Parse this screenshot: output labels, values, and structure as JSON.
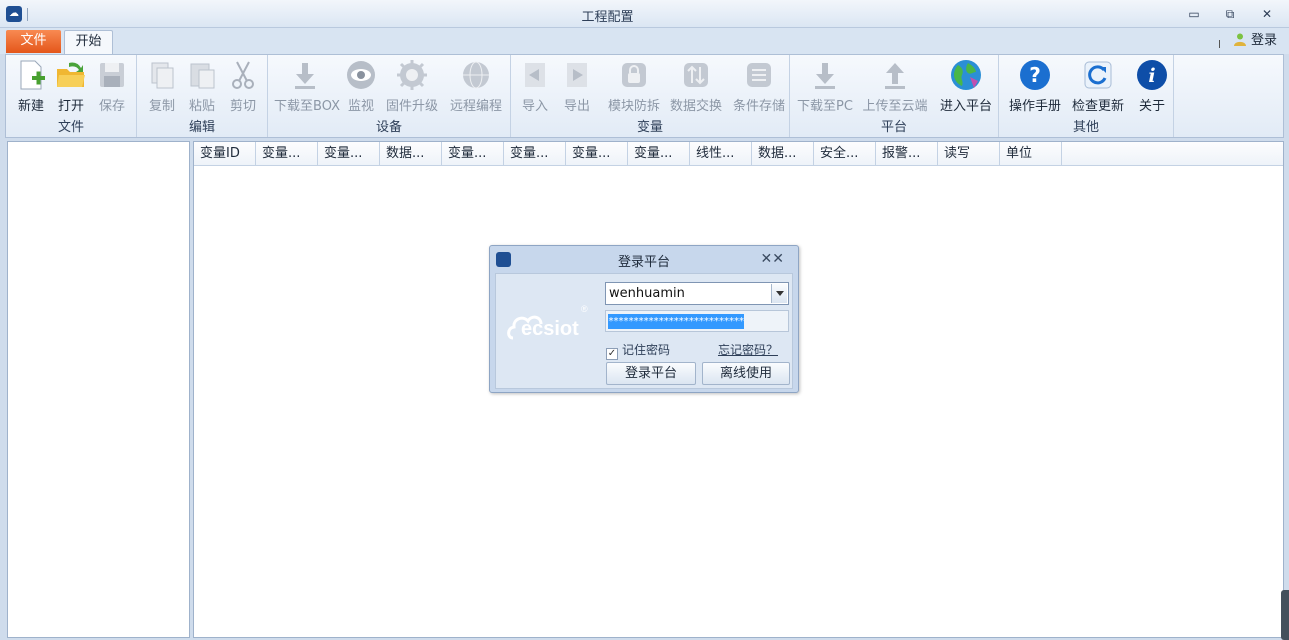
{
  "window": {
    "title": "工程配置",
    "minimize": "▭",
    "restore": "⧉",
    "close": "✕"
  },
  "tabs": {
    "file": "文件",
    "start": "开始",
    "login": "登录"
  },
  "ribbon": {
    "groups": {
      "file": "文件",
      "edit": "编辑",
      "device": "设备",
      "variable": "变量",
      "platform": "平台",
      "other": "其他"
    },
    "buttons": {
      "new": "新建",
      "open": "打开",
      "save": "保存",
      "copy": "复制",
      "paste": "粘贴",
      "cut": "剪切",
      "download_box": "下载至BOX",
      "monitor": "监视",
      "firmware": "固件升级",
      "remote": "远程编程",
      "import": "导入",
      "export": "导出",
      "module_protect": "模块防拆",
      "data_exchange": "数据交换",
      "cond_storage": "条件存储",
      "download_pc": "下载至PC",
      "upload_cloud": "上传至云端",
      "enter_platform": "进入平台",
      "manual": "操作手册",
      "check_update": "检查更新",
      "about": "关于"
    }
  },
  "grid": {
    "columns": [
      "变量ID",
      "变量...",
      "变量...",
      "数据...",
      "变量...",
      "变量...",
      "变量...",
      "变量...",
      "线性...",
      "数据...",
      "安全...",
      "报警...",
      "读写",
      "单位"
    ]
  },
  "dialog": {
    "title": "登录平台",
    "close": "✕✕",
    "logo_text": "ecsiot",
    "logo_mark": "®",
    "username": "wenhuamin",
    "password_mask": "****************************",
    "remember_label": "记住密码",
    "remember_check": "✓",
    "forgot_label": "忘记密码？",
    "login_button": "登录平台",
    "offline_button": "离线使用"
  }
}
